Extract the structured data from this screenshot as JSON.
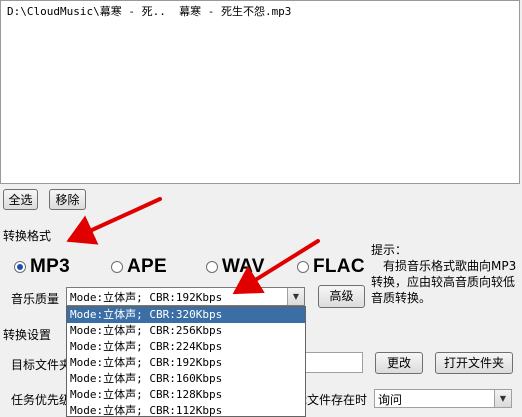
{
  "file_list": {
    "items": [
      "D:\\CloudMusic\\幕寒 - 死..  幕寒 - 死生不怨.mp3"
    ]
  },
  "buttons": {
    "select_all": "全选",
    "remove": "移除",
    "advanced": "高级",
    "change": "更改",
    "open_folder": "打开文件夹"
  },
  "format_section": {
    "title": "转换格式",
    "formats": [
      {
        "label": "MP3",
        "checked": true
      },
      {
        "label": "APE",
        "checked": false
      },
      {
        "label": "WAV",
        "checked": false
      },
      {
        "label": "FLAC",
        "checked": false
      }
    ],
    "quality_label": "音乐质量",
    "quality_selected": "Mode:立体声; CBR:192Kbps",
    "quality_options": [
      "Mode:立体声; CBR:320Kbps",
      "Mode:立体声; CBR:256Kbps",
      "Mode:立体声; CBR:224Kbps",
      "Mode:立体声; CBR:192Kbps",
      "Mode:立体声; CBR:160Kbps",
      "Mode:立体声; CBR:128Kbps",
      "Mode:立体声; CBR:112Kbps"
    ],
    "quality_highlighted_index": 0
  },
  "hint": {
    "title": "提示：",
    "body": "有损音乐格式歌曲向MP3转换，应由较高音质向较低音质转换。"
  },
  "settings_section": {
    "title": "转换设置",
    "target_folder_label": "目标文件夹",
    "task_priority_label": "任务优先级",
    "file_exists_label": "目标文件存在时",
    "file_exists_value": "询问"
  },
  "colors": {
    "annotation_arrow": "#e00000",
    "selection": "#3a6ea5"
  }
}
